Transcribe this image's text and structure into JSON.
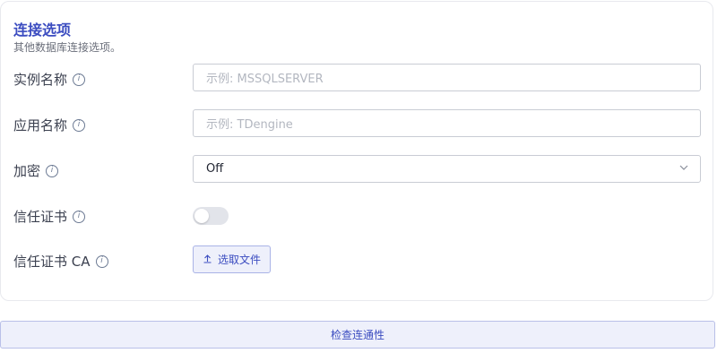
{
  "section": {
    "title": "连接选项",
    "subtitle": "其他数据库连接选项。"
  },
  "fields": {
    "instance_name": {
      "label": "实例名称",
      "placeholder": "示例: MSSQLSERVER",
      "value": ""
    },
    "app_name": {
      "label": "应用名称",
      "placeholder": "示例: TDengine",
      "value": ""
    },
    "encrypt": {
      "label": "加密",
      "value": "Off"
    },
    "trust_cert": {
      "label": "信任证书",
      "enabled": false
    },
    "trust_cert_ca": {
      "label": "信任证书 CA",
      "button_label": "选取文件"
    }
  },
  "info_glyph": "i",
  "check_button_label": "检查连通性",
  "colors": {
    "accent": "#3b4cc0",
    "button_bg": "#eef0fb"
  }
}
